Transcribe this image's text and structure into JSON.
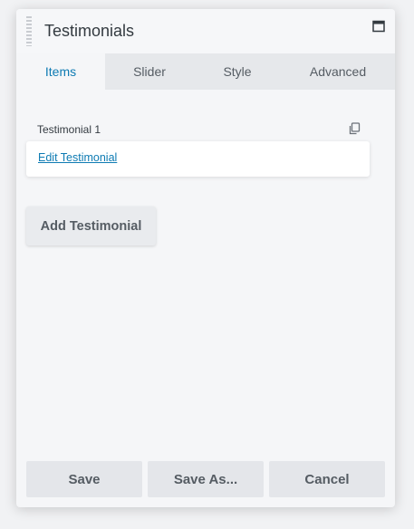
{
  "panel": {
    "title": "Testimonials"
  },
  "tabs": [
    {
      "label": "Items",
      "active": true
    },
    {
      "label": "Slider",
      "active": false
    },
    {
      "label": "Style",
      "active": false
    },
    {
      "label": "Advanced",
      "active": false
    }
  ],
  "items": [
    {
      "label": "Testimonial 1",
      "edit_label": "Edit Testimonial"
    }
  ],
  "add_button_label": "Add Testimonial",
  "footer": {
    "save_label": "Save",
    "save_as_label": "Save As...",
    "cancel_label": "Cancel"
  },
  "colors": {
    "accent": "#0e7bb3",
    "text": "#333a40",
    "muted_text": "#555c63",
    "tab_bar": "#e6e8eb",
    "panel_bg": "#f5f6f8"
  },
  "icons": {
    "drag": "drag-handle-icon",
    "maximize": "maximize-icon",
    "copy": "copy-icon"
  }
}
